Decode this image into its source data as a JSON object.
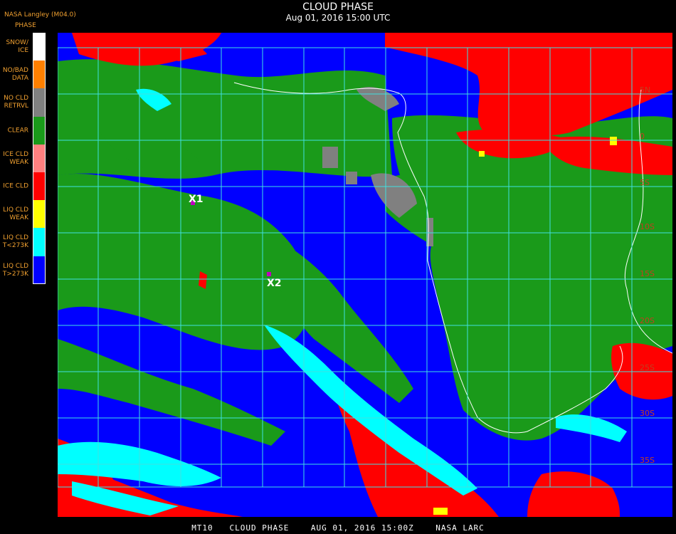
{
  "header": {
    "title": "CLOUD PHASE",
    "datetime": "Aug 01, 2016 15:00 UTC",
    "source": "NASA Langley (M04.0)"
  },
  "legend": {
    "title": "PHASE",
    "items": [
      {
        "label": "SNOW/\nICE",
        "color": "#ffffff"
      },
      {
        "label": "NO/BAD\nDATA",
        "color": "#ff8000"
      },
      {
        "label": "NO CLD\nRETRVL",
        "color": "#808080"
      },
      {
        "label": "CLEAR",
        "color": "#1a9a1a"
      },
      {
        "label": "ICE CLD\nWEAK",
        "color": "#ff8080"
      },
      {
        "label": "ICE CLD",
        "color": "#ff0000"
      },
      {
        "label": "LIQ CLD\nWEAK",
        "color": "#ffff00"
      },
      {
        "label": "LIQ CLD\nT<273K",
        "color": "#00ffff"
      },
      {
        "label": "LIQ CLD\nT>273K",
        "color": "#0000ff"
      }
    ]
  },
  "map": {
    "markers": [
      {
        "label": "X1"
      },
      {
        "label": "X2"
      }
    ],
    "lat_labels": [
      "5N",
      "0",
      "5S",
      "10S",
      "15S",
      "20S",
      "25S",
      "30S",
      "35S"
    ]
  },
  "footer": {
    "text": "MT10   CLOUD PHASE    AUG 01, 2016 15:00Z    NASA LARC"
  },
  "colors": {
    "ice": "#ff0000",
    "liquid_warm": "#0000ff",
    "liquid_cold": "#00ffff",
    "clear": "#1a9a1a",
    "no_retrieval": "#808080",
    "grid": "#40e0e0",
    "coast": "#ffffff",
    "lat_label": "#c04020",
    "marker": "#c000c0"
  }
}
